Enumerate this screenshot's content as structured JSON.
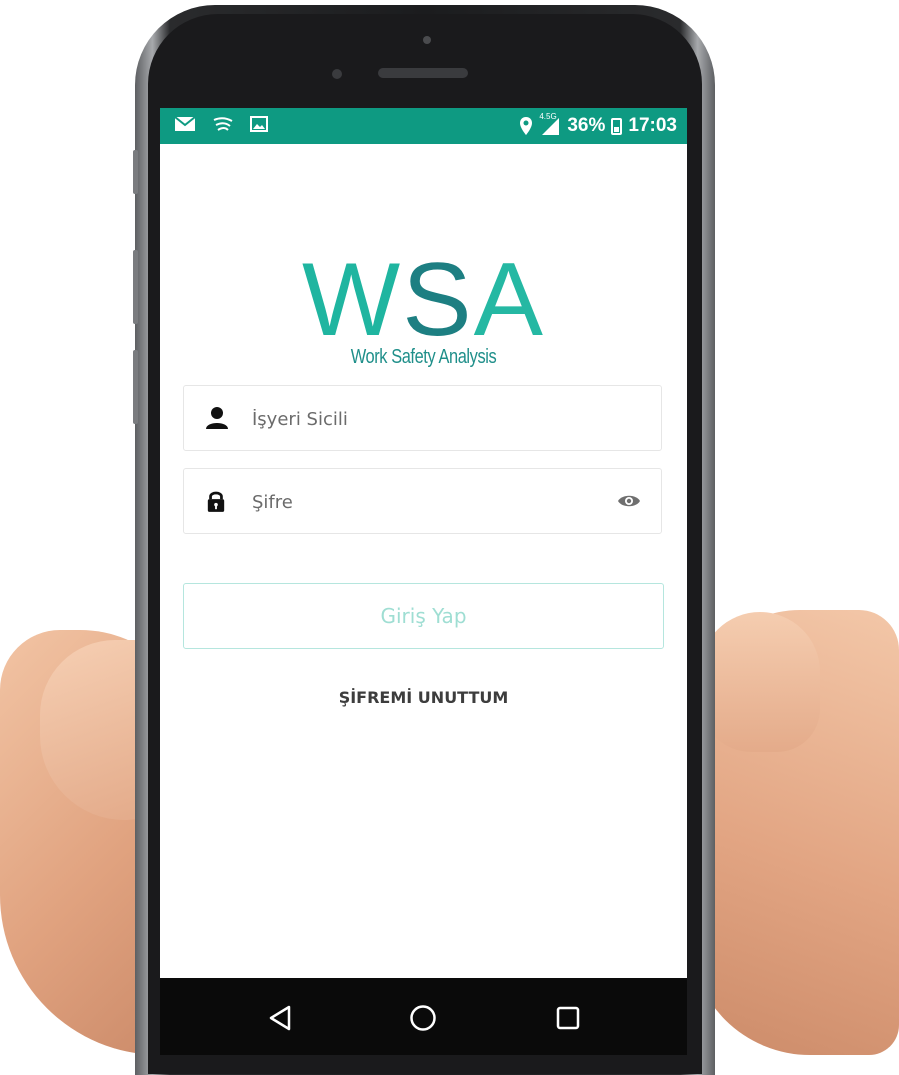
{
  "status_bar": {
    "battery_percent": "36%",
    "time": "17:03",
    "network_tag": "4.5G",
    "left_icons": [
      "mail-icon",
      "sync-icon",
      "image-icon"
    ],
    "right_icons": [
      "location-icon",
      "signal-icon",
      "battery-icon"
    ]
  },
  "logo": {
    "w": "W",
    "s": "S",
    "a": "A",
    "subtitle": "Work Safety Analysis"
  },
  "login": {
    "username_placeholder": "İşyeri Sicili",
    "password_placeholder": "Şifre",
    "submit_label": "Giriş Yap",
    "forgot_label": "ŞİFREMİ UNUTTUM"
  },
  "nav": {
    "icons": [
      "back-icon",
      "home-icon",
      "recents-icon"
    ]
  },
  "colors": {
    "status_bar": "#0e9a82",
    "brand_teal": "#1fb5a0",
    "brand_dark_teal": "#1d7f82",
    "button_border": "#b5e6de",
    "button_text": "#9fded3"
  }
}
